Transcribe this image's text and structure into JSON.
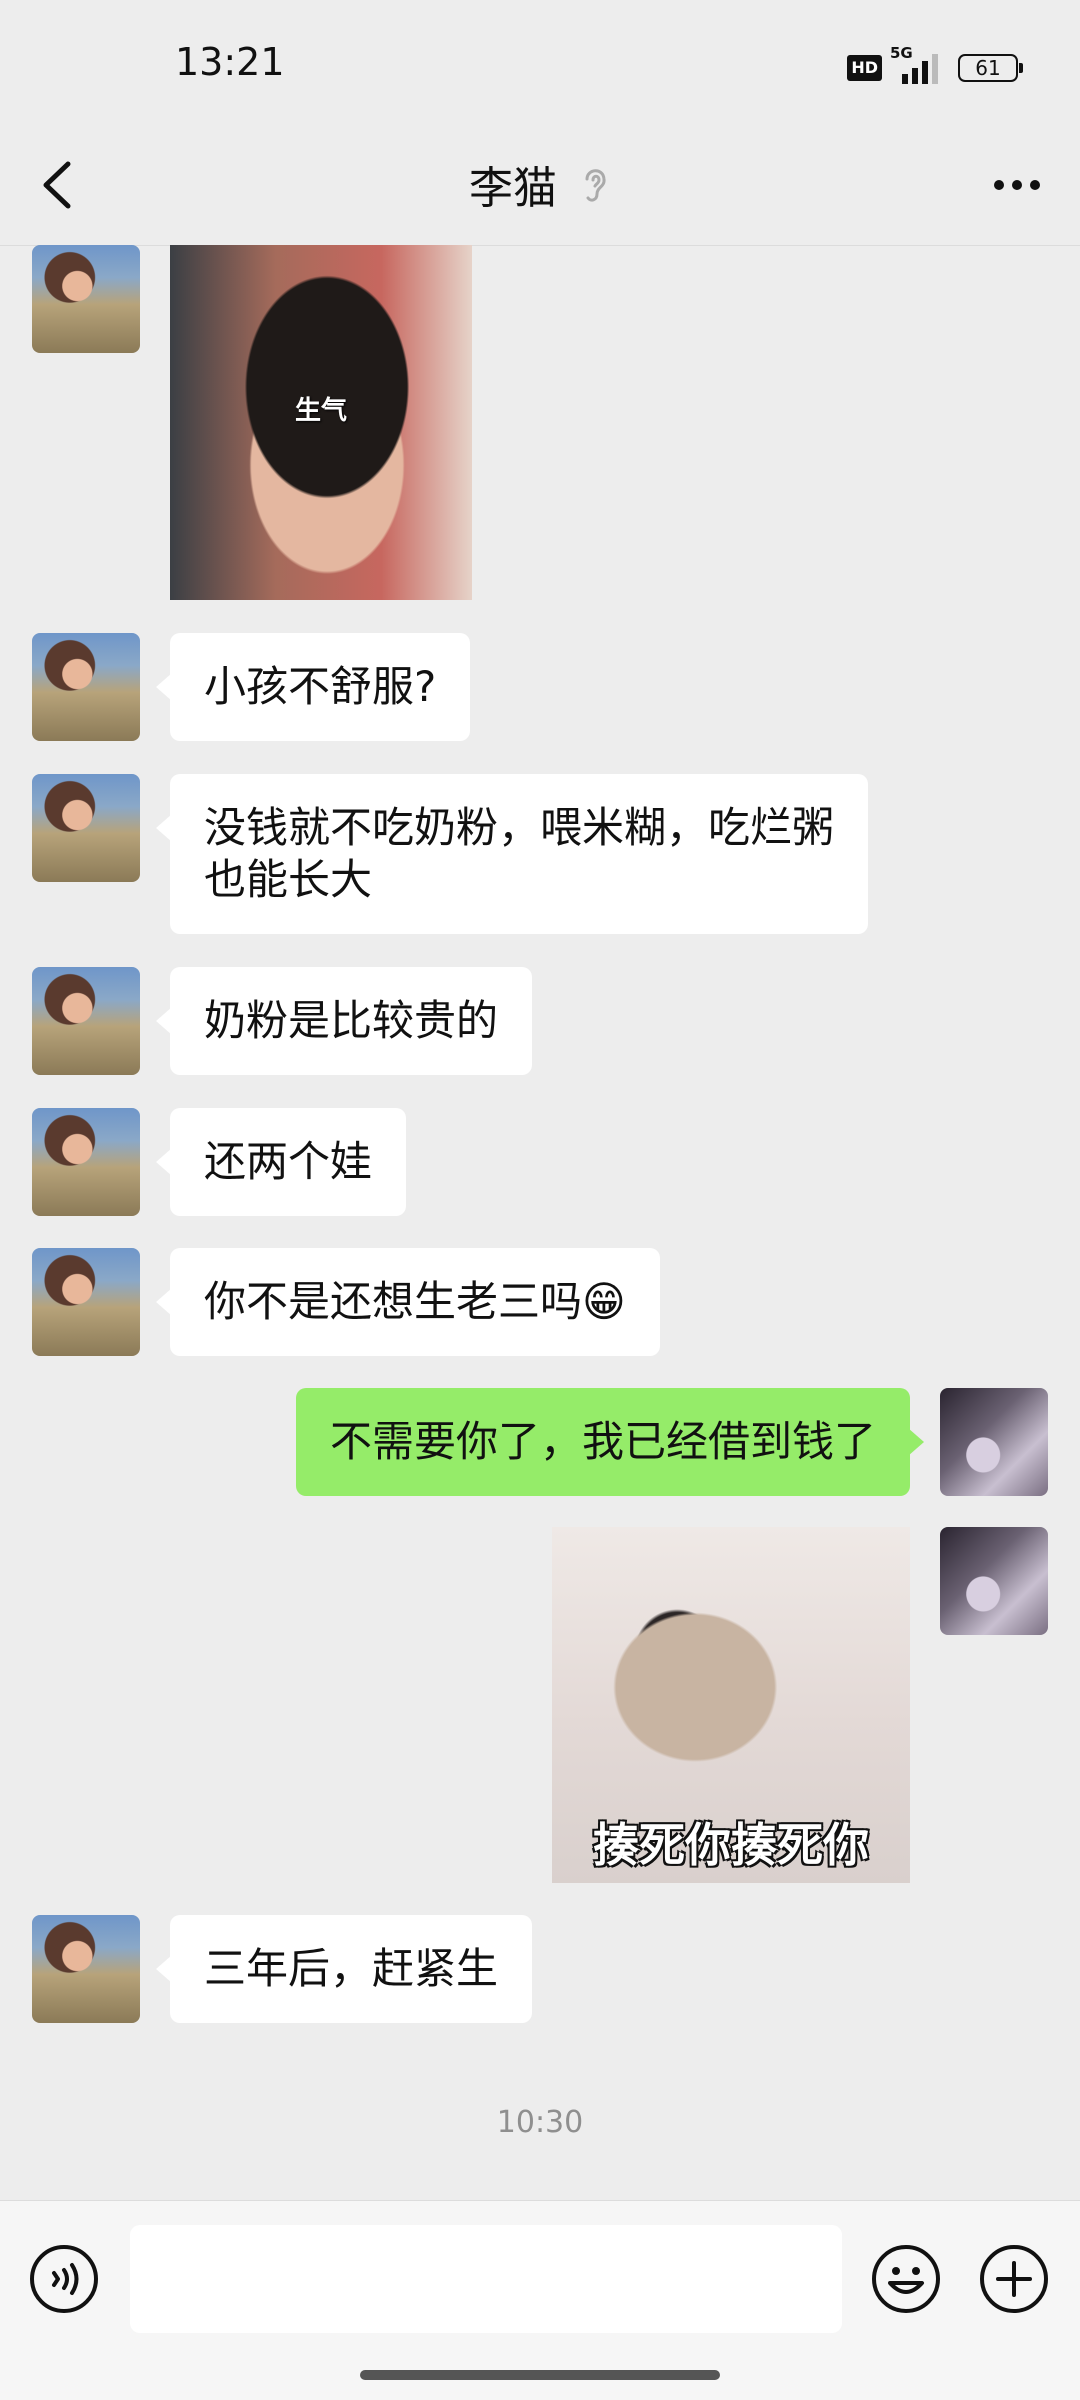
{
  "status_bar": {
    "time": "13:21",
    "hd": "HD",
    "network": "5G",
    "battery": "61"
  },
  "header": {
    "title": "李猫"
  },
  "messages": {
    "m1_sticker_label": "生气",
    "m2": "小孩不舒服?",
    "m3": "没钱就不吃奶粉，喂米糊，吃烂粥\n也能长大",
    "m4": "奶粉是比较贵的",
    "m5": "还两个娃",
    "m6": "你不是还想生老三吗😁",
    "m7": "不需要你了，我已经借到钱了",
    "m8_sticker_caption": "揍死你揍死你",
    "m9": "三年后，赶紧生"
  },
  "timestamp": "10:30",
  "input": {
    "value": ""
  },
  "colors": {
    "background": "#ededed",
    "bubble_left": "#ffffff",
    "bubble_right": "#95ec69"
  },
  "icons": {
    "back": "chevron-left-icon",
    "ear": "ear-icon",
    "more": "more-dots-icon",
    "voice": "voice-icon",
    "emoji": "emoji-icon",
    "plus": "plus-icon"
  }
}
